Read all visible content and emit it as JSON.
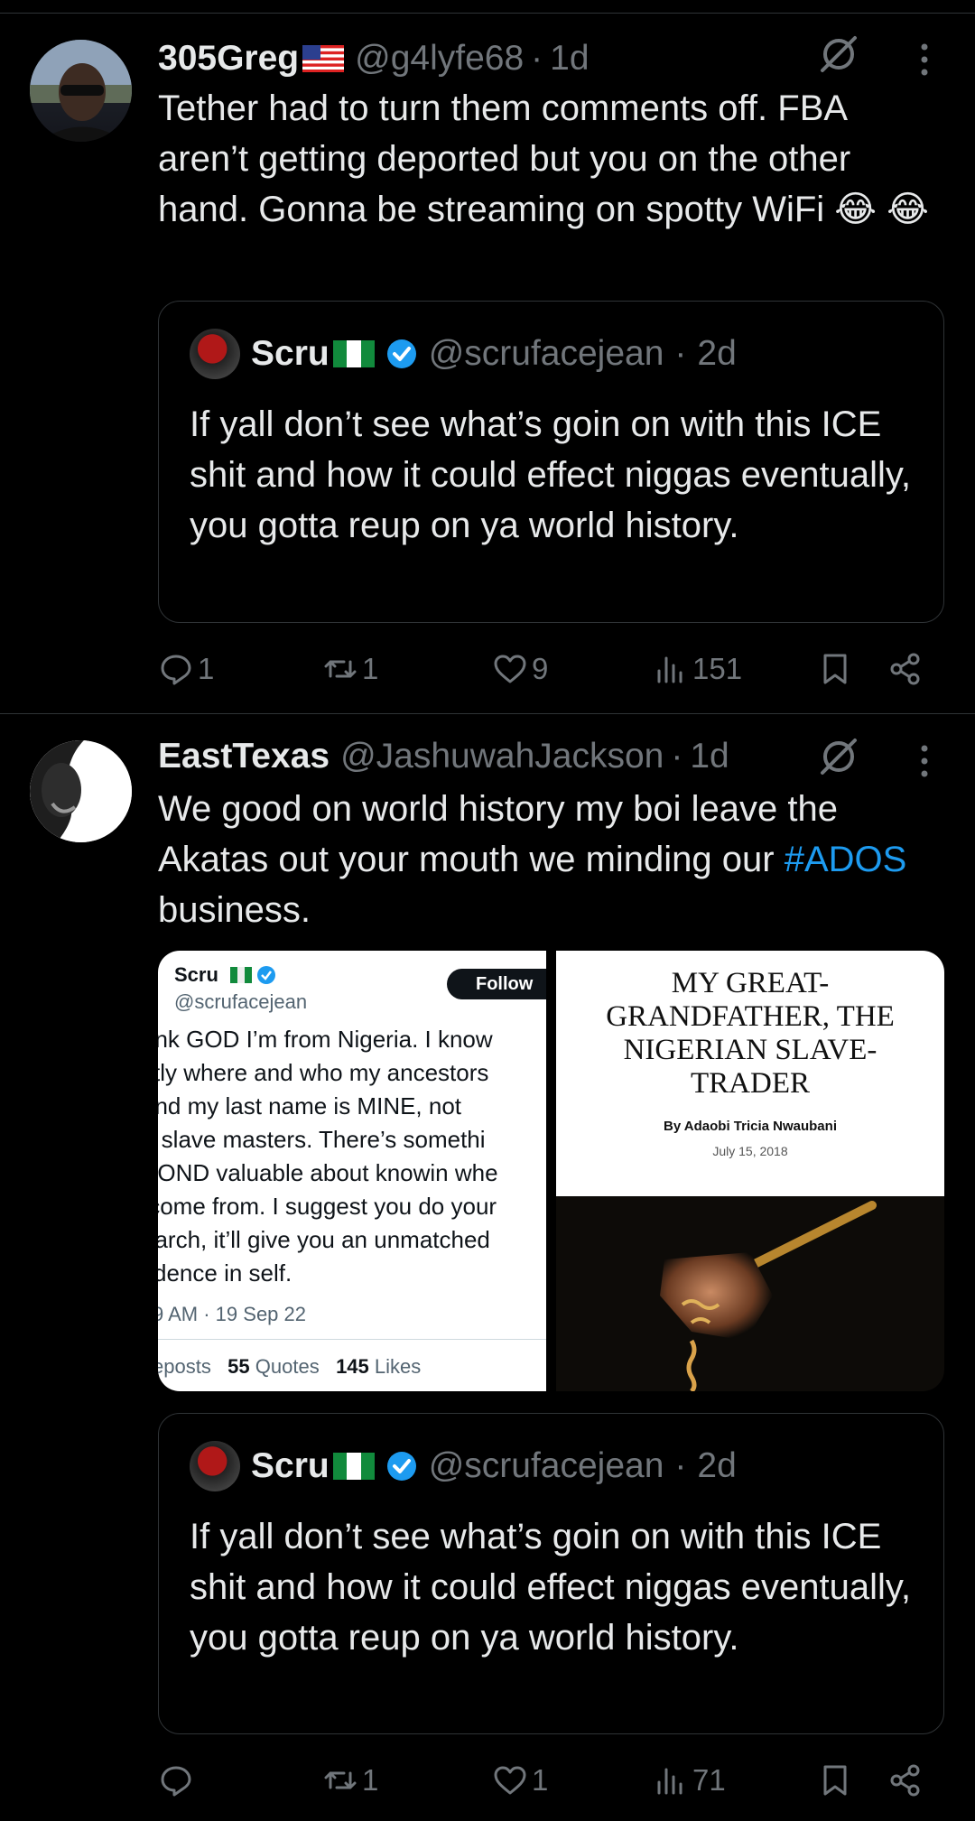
{
  "tweets": [
    {
      "name": "305Greg",
      "handle": "@g4lyfe68",
      "dot": "·",
      "time": "1d",
      "text": "Tether had to turn them comments off. FBA aren’t getting deported but you on the other hand. Gonna be streaming on spotty WiFi 😂 😂",
      "quote": {
        "name": "Scru",
        "handle": "@scrufacejean",
        "dot": "·",
        "time": "2d",
        "text": "If yall don’t see what’s goin on with this ICE shit and how it could effect niggas eventually, you gotta reup on ya world history."
      },
      "replies": "1",
      "reposts": "1",
      "likes": "9",
      "views": "151"
    },
    {
      "name": "EastTexas",
      "handle": "@JashuwahJackson",
      "dot": "·",
      "time": "1d",
      "text_before": "We good on world history my boi leave the Akatas out your mouth we minding our ",
      "hashtag": "#ADOS",
      "text_after": " business.",
      "media_left": {
        "name": "Scru",
        "handle": "@scrufacejean",
        "follow": "Follow",
        "text": "ank GOD I’m from Nigeria. I know\nctly where and who my ancestors\nand my last name is MINE, not\ne slave masters. There’s somethi\nYOND valuable about knowin whe\n come from. I suggest you do your\nearch, it’ll give you an unmatched\nfidence in self.",
        "timestamp": "9 AM · 19 Sep 22",
        "reposts_label": "eposts",
        "quotes_count": "55",
        "quotes_label": "Quotes",
        "likes_count": "145",
        "likes_label": "Likes"
      },
      "media_right": {
        "headline": "MY GREAT-GRANDFATHER, THE NIGERIAN SLAVE-TRADER",
        "byline": "By Adaobi Tricia Nwaubani",
        "date": "July 15, 2018"
      },
      "quote": {
        "name": "Scru",
        "handle": "@scrufacejean",
        "dot": "·",
        "time": "2d",
        "text": "If yall don’t see what’s goin on with this ICE shit and how it could effect niggas eventually, you gotta reup on ya world history."
      },
      "reposts": "1",
      "likes": "1",
      "views": "71"
    }
  ],
  "colors": {
    "background": "#000000",
    "text": "#e7e9ea",
    "muted": "#71767b",
    "accent": "#1d9bf0",
    "border": "#2f3336"
  },
  "icons": [
    "grok-icon",
    "more-icon",
    "reply-icon",
    "repost-icon",
    "like-icon",
    "views-icon",
    "bookmark-icon",
    "share-icon",
    "verified-icon",
    "flag-us-icon",
    "flag-nigeria-icon"
  ]
}
